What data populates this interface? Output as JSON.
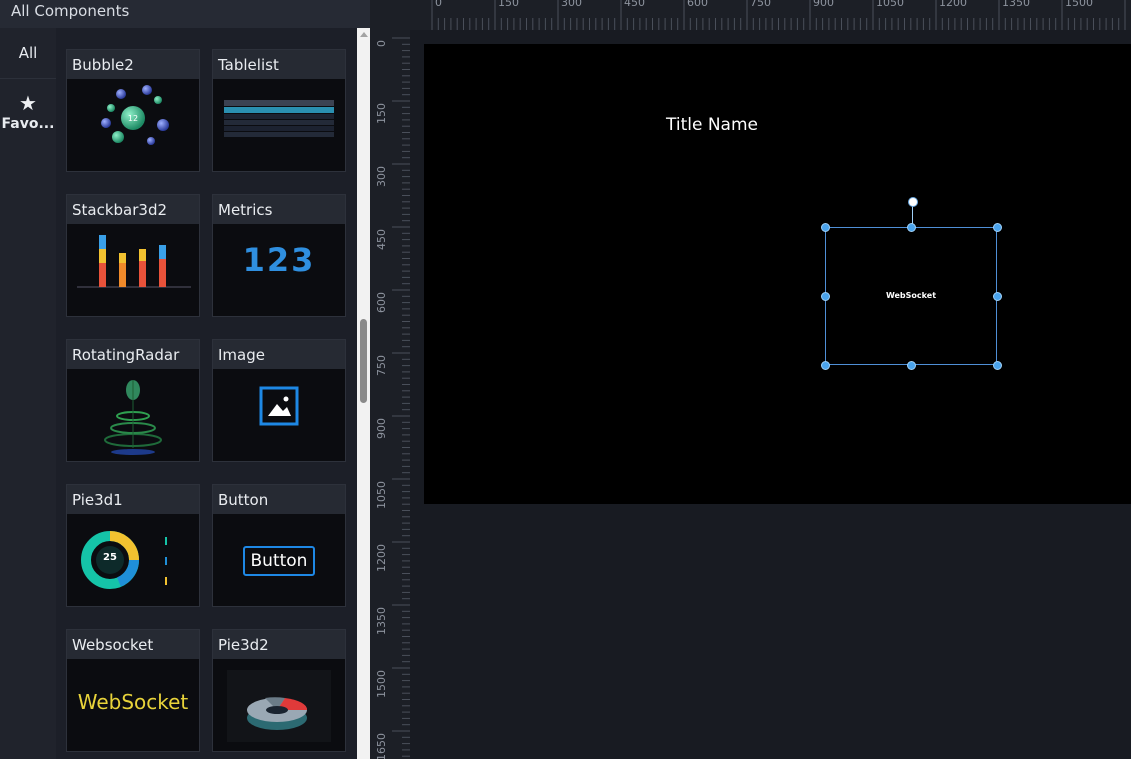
{
  "panel": {
    "header": "All Components",
    "categories": {
      "all": "All",
      "favorites": "Favo..."
    }
  },
  "components": [
    {
      "title": "Bubble2"
    },
    {
      "title": "Tablelist"
    },
    {
      "title": "Stackbar3d2"
    },
    {
      "title": "Metrics",
      "thumb_text": "123"
    },
    {
      "title": "RotatingRadar"
    },
    {
      "title": "Image"
    },
    {
      "title": "Pie3d1",
      "thumb_text": "25"
    },
    {
      "title": "Button",
      "thumb_text": "Button"
    },
    {
      "title": "Websocket",
      "thumb_text": "WebSocket"
    },
    {
      "title": "Pie3d2"
    }
  ],
  "ruler": {
    "top_labels": [
      "0",
      "150",
      "300",
      "450",
      "600",
      "750",
      "900",
      "1050",
      "1200",
      "1350",
      "1500"
    ],
    "left_labels": [
      "0",
      "150",
      "300",
      "450",
      "600",
      "750",
      "900",
      "1050",
      "1200",
      "1350",
      "1500",
      "1650"
    ]
  },
  "canvas": {
    "title": "Title Name",
    "selected_component_label": "WebSocket"
  },
  "colors": {
    "accent": "#4aa3ec",
    "panel_bg": "#1c1f28",
    "stage_bg": "#000000",
    "websocket_text": "#e8d33a",
    "metrics_blue": "#2f8fe0",
    "image_blue": "#1e88e5"
  }
}
